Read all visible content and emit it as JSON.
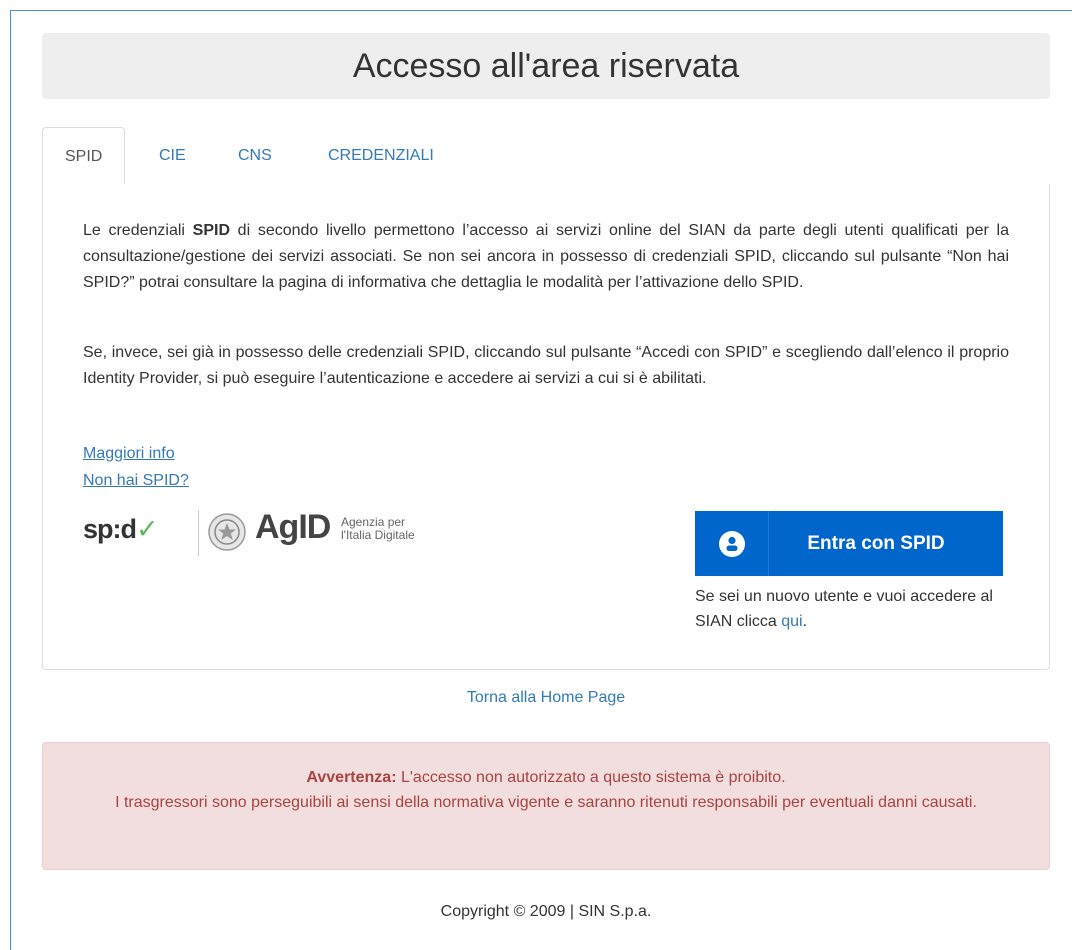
{
  "header": {
    "title": "Accesso all'area riservata"
  },
  "tabs": [
    {
      "label": "SPID",
      "active": true
    },
    {
      "label": "CIE",
      "active": false
    },
    {
      "label": "CNS",
      "active": false
    },
    {
      "label": "CREDENZIALI",
      "active": false
    }
  ],
  "spid_panel": {
    "para1_prefix": "Le credenziali ",
    "para1_bold": "SPID",
    "para1_suffix": " di secondo livello permettono l’accesso ai servizi online del SIAN da parte degli utenti qualificati per la consultazione/gestione dei servizi associati. Se non sei ancora in possesso di credenziali SPID, cliccando sul pulsante “Non hai SPID?” potrai consultare la pagina di informativa che dettaglia le modalità per l’attivazione dello SPID.",
    "para2": "Se, invece, sei già in possesso delle credenziali SPID, cliccando sul pulsante “Accedi con SPID” e scegliendo dall’elenco il proprio Identity Provider, si può eseguire l’autenticazione e accedere ai servizi a cui si è abilitati.",
    "link_more_info": "Maggiori info",
    "link_no_spid": "Non hai SPID?",
    "logo_spid_text": "sp:d",
    "logo_spid_check": "✓",
    "logo_agid_text": "AgID",
    "logo_agid_sub1": "Agenzia per",
    "logo_agid_sub2": "l'Italia Digitale",
    "login_button_label": "Entra con SPID",
    "new_user_text": "Se sei un nuovo utente e vuoi accedere al SIAN clicca ",
    "new_user_link": "qui",
    "new_user_suffix": "."
  },
  "footer_links": {
    "home": "Torna alla Home Page"
  },
  "alert": {
    "title": "Avvertenza:",
    "line1": " L'accesso non autorizzato a questo sistema è proibito.",
    "line2": "I trasgressori sono perseguibili ai sensi della normativa vigente e saranno ritenuti responsabili per eventuali danni causati."
  },
  "copyright": "Copyright © 2009 | SIN S.p.a.",
  "colors": {
    "link": "#337ab7",
    "spid_blue": "#0066cc",
    "alert_bg": "#f2dede",
    "alert_text": "#a94442"
  }
}
